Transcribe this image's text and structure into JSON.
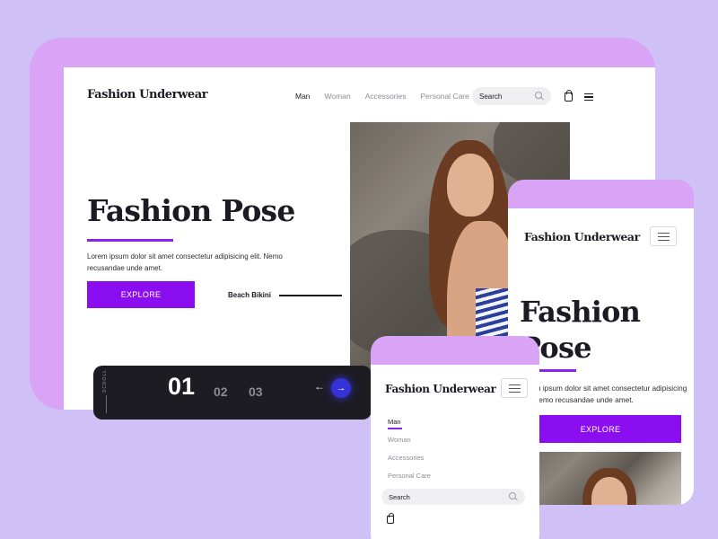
{
  "tablet": {
    "brand": "Fashion Underwear",
    "nav": [
      "Man",
      "Woman",
      "Accessories",
      "Personal Care"
    ],
    "search_placeholder": "Search",
    "hero_title": "Fashion Pose",
    "lorem": "Lorem ipsum dolor sit amet consectetur adipisicing elit. Nemo recusandae unde amet.",
    "explore_label": "EXPLORE",
    "beach_label": "Beach Bikini",
    "slider": {
      "scroll_label": "SCROLL",
      "current": "01",
      "next": "02",
      "third": "03",
      "prev_arrow": "←",
      "next_arrow": "→"
    }
  },
  "phone_right": {
    "brand": "Fashion Underwear",
    "hero_title": "Fashion Pose",
    "lorem": "Lorem ipsum dolor sit amet consectetur adipisicing elit. Nemo recusandae unde amet.",
    "explore_label": "EXPLORE"
  },
  "phone_bottom": {
    "brand": "Fashion Underwear",
    "nav": [
      "Man",
      "Woman",
      "Accessories",
      "Personal Care"
    ],
    "search_placeholder": "Search"
  },
  "colors": {
    "background": "#cfc0f5",
    "device": "#d9a4f6",
    "accent": "#8a0ef0",
    "slider_button": "#3532d6"
  },
  "icons": [
    "search-icon",
    "shopping-bag-icon",
    "hamburger-menu-icon",
    "arrow-left-icon",
    "arrow-right-icon"
  ]
}
